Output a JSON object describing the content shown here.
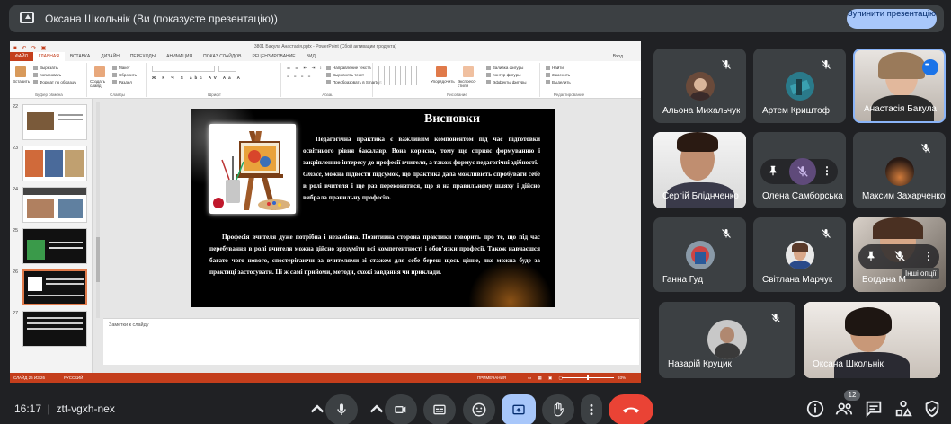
{
  "meeting": {
    "presenter_title": "Оксана Школьнік (Ви (показуєте презентацію))",
    "stop_button": "Зупинити презентацію",
    "time": "16:17",
    "meeting_code": "ztt-vgxh-nex",
    "participant_count": "12"
  },
  "powerpoint": {
    "window_title": "3801 Бакулa Анастасія.pptx - PowerPoint (Сбой активации продукта)",
    "signin": "Вход",
    "tabs": [
      "ФАЙЛ",
      "ГЛАВНАЯ",
      "ВСТАВКА",
      "ДИЗАЙН",
      "ПЕРЕХОДЫ",
      "АНИМАЦИЯ",
      "ПОКАЗ СЛАЙДОВ",
      "РЕЦЕНЗИРОВАНИЕ",
      "ВИД"
    ],
    "ribbon": {
      "paste": "Вставить",
      "cut": "Вырезать",
      "copy": "Копировать",
      "format_painter": "Формат по образцу",
      "clipboard_group": "Буфер обмена",
      "new_slide": "Создать слайд",
      "layout": "Макет",
      "reset": "Сбросить",
      "section": "Раздел",
      "slides_group": "Слайды",
      "font_group": "Шрифт",
      "paragraph_group": "Абзац",
      "text_direction": "Направление текста",
      "align_text": "Выровнять текст",
      "smartart": "Преобразовать в SmartArt",
      "drawing_group": "Рисование",
      "arrange": "Упорядочить",
      "quick_styles": "Экспресс-стили",
      "shape_fill": "Заливка фигуры",
      "shape_outline": "Контур фигуры",
      "shape_effects": "Эффекты фигуры",
      "find": "Найти",
      "replace": "Заменить",
      "select": "Выделить",
      "editing_group": "Редактирование"
    },
    "thumbnails": [
      {
        "num": "22"
      },
      {
        "num": "23"
      },
      {
        "num": "24"
      },
      {
        "num": "25"
      },
      {
        "num": "26"
      },
      {
        "num": "27"
      }
    ],
    "slide": {
      "title": "Висновки",
      "para1_lead": "Педагогічна практика є важливим компонентом під час підготовки освітнього рівня бакалавр. Вона корисна, тому що сприяє формуванню і закріпленню інтересу до професії вчителя, а також формує педагогічні здібності.",
      "para1_em": "Отже,",
      "para1_rest": " можна підвести підсумок, що практика дала можливість спробувати себе в ролі вчителя і ще раз переконатися, що я на правильному шляху і дійсно вибрала правильну професію.",
      "para2": "Професія вчителя дуже потрібна і незамінна. Позитивна сторона практики говорить про те, що під час перебування в ролі вчителя можна дійсно зрозуміти всі компетентності і обов'язки професії. Також навчаєшся багато чого нового, спостерігаючи за вчителями зі стажем для себе береш щось цінне, яке можна буде за практиці застосувати. Ці ж самі прийоми, методи, схожі завдання чи приклади."
    },
    "notes_placeholder": "Заметки к слайду",
    "status": {
      "slide_count": "СЛАЙД 26 ИЗ 26",
      "language": "РУССКИЙ",
      "notes": "ПРИМЕЧАНИЯ",
      "zoom": "93%"
    }
  },
  "participants": [
    {
      "name": "Альона Михальчук"
    },
    {
      "name": "Артем Криштоф"
    },
    {
      "name": "Анастасія Бакула"
    },
    {
      "name": "Сергій Бліднченко"
    },
    {
      "name": "Олена Самборська"
    },
    {
      "name": "Максим Захарченко"
    },
    {
      "name": "Ганна Гуд"
    },
    {
      "name": "Світлана Марчук"
    },
    {
      "name": "Богдана М"
    },
    {
      "name": "Назарій Круцик"
    },
    {
      "name": "Оксана Школьнік"
    }
  ],
  "other_options": "Інші опції",
  "colors": {
    "meet_bg": "#202124",
    "tile_bg": "#3c4043",
    "accent_blue": "#a8c7fa",
    "end_call_red": "#ea4335",
    "ppt_orange": "#c43e1c"
  }
}
